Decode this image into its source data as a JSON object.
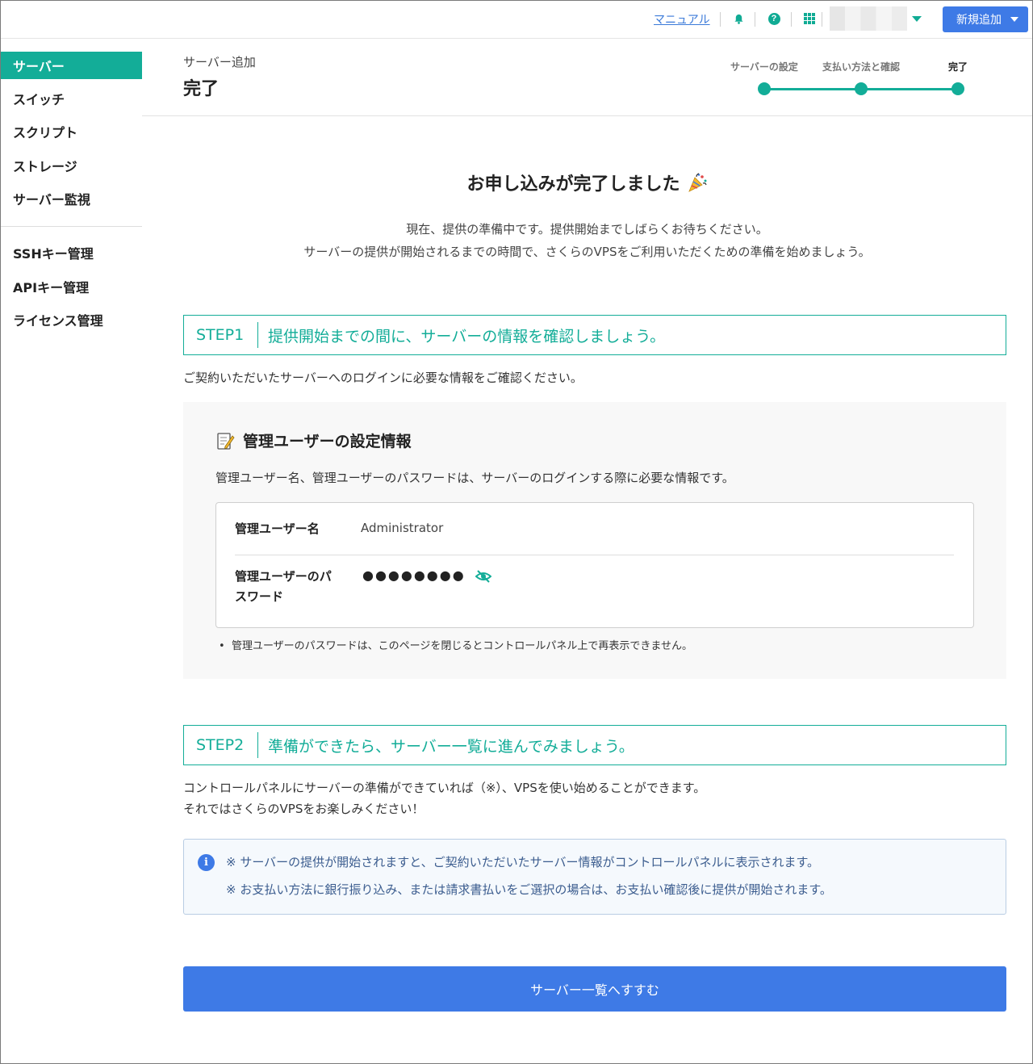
{
  "header": {
    "manual_label": "マニュアル",
    "new_button_label": "新規追加"
  },
  "sidebar": {
    "items": [
      {
        "label": "サーバー"
      },
      {
        "label": "スイッチ"
      },
      {
        "label": "スクリプト"
      },
      {
        "label": "ストレージ"
      },
      {
        "label": "サーバー監視"
      },
      {
        "label": "SSHキー管理"
      },
      {
        "label": "APIキー管理"
      },
      {
        "label": "ライセンス管理"
      }
    ]
  },
  "page": {
    "breadcrumb": "サーバー追加",
    "title": "完了"
  },
  "stepper": {
    "steps": [
      "サーバーの設定",
      "支払い方法と確認",
      "完了"
    ]
  },
  "main": {
    "done_title": "お申し込みが完了しました",
    "lead_1": "現在、提供の準備中です。提供開始までしばらくお待ちください。",
    "lead_2": "サーバーの提供が開始されるまでの時間で、さくらのVPSをご利用いただくための準備を始めましょう。",
    "step1_tag": "STEP1",
    "step1_text": "提供開始までの間に、サーバーの情報を確認しましょう。",
    "step1_desc": "ご契約いただいたサーバーへのログインに必要な情報をご確認ください。",
    "panel_title": "管理ユーザーの設定情報",
    "panel_desc": "管理ユーザー名、管理ユーザーのパスワードは、サーバーのログインする際に必要な情報です。",
    "user_label": "管理ユーザー名",
    "user_value": "Administrator",
    "pw_label_1": "管理ユーザーのパ",
    "pw_label_2": "スワード",
    "pw_masked": "●●●●●●●●",
    "note": "管理ユーザーのパスワードは、このページを閉じるとコントロールパネル上で再表示できません。",
    "step2_tag": "STEP2",
    "step2_text": "準備ができたら、サーバー一覧に進んでみましょう。",
    "step2_desc_1": "コントロールパネルにサーバーの準備ができていれば（※）、VPSを使い始めることができます。",
    "step2_desc_2": "それではさくらのVPSをお楽しみください！",
    "alert_1": "※ サーバーの提供が開始されますと、ご契約いただいたサーバー情報がコントロールパネルに表示されます。",
    "alert_2": "※ お支払い方法に銀行振り込み、または請求書払いをご選択の場合は、お支払い確認後に提供が開始されます。",
    "cta_label": "サーバー一覧へすすむ"
  },
  "colors": {
    "accent": "#13ad98",
    "primary": "#3e7ae6"
  }
}
